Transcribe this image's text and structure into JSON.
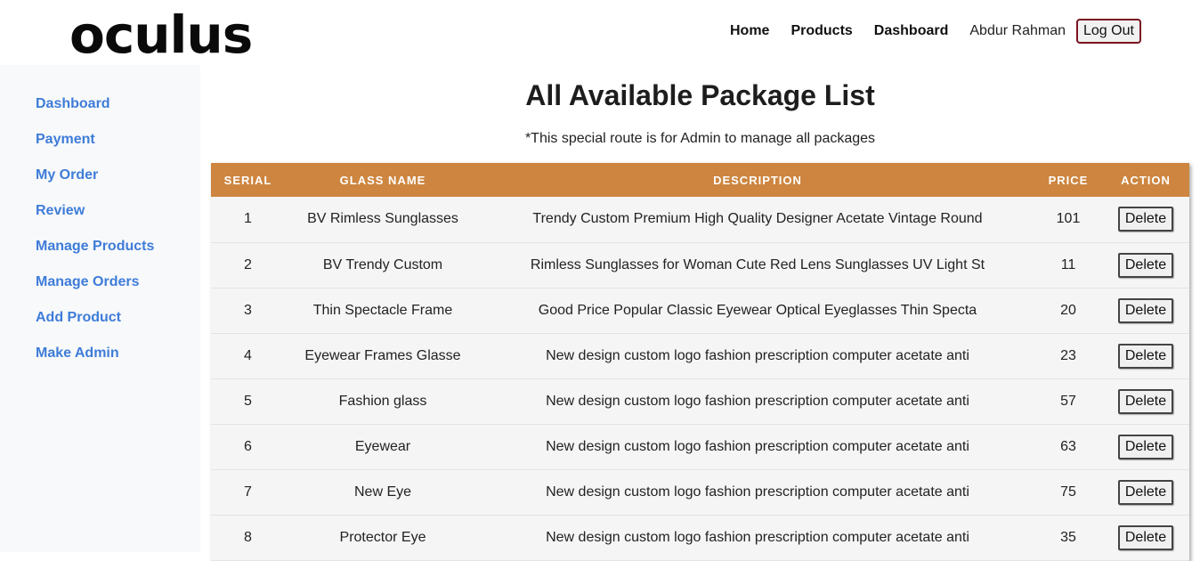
{
  "brand": {
    "logo_text": "oculus"
  },
  "nav": {
    "home": "Home",
    "products": "Products",
    "dashboard": "Dashboard",
    "user_name": "Abdur Rahman",
    "logout": "Log Out"
  },
  "sidebar": {
    "items": [
      {
        "label": "Dashboard"
      },
      {
        "label": "Payment"
      },
      {
        "label": "My Order"
      },
      {
        "label": "Review"
      },
      {
        "label": "Manage Products"
      },
      {
        "label": "Manage Orders"
      },
      {
        "label": "Add Product"
      },
      {
        "label": "Make Admin"
      }
    ]
  },
  "page": {
    "title": "All Available Package List",
    "subtitle": "*This special route is for Admin to manage all packages"
  },
  "table": {
    "headers": [
      "SERIAL",
      "GLASS NAME",
      "DESCRIPTION",
      "PRICE",
      "ACTION"
    ],
    "rows": [
      {
        "serial": "1",
        "name": "BV Rimless Sunglasses",
        "description": "Trendy Custom Premium High Quality Designer Acetate Vintage Round",
        "price": "101",
        "action": "Delete"
      },
      {
        "serial": "2",
        "name": "BV Trendy Custom",
        "description": "Rimless Sunglasses for Woman Cute Red Lens Sunglasses UV Light St",
        "price": "11",
        "action": "Delete"
      },
      {
        "serial": "3",
        "name": "Thin Spectacle Frame",
        "description": "Good Price Popular Classic Eyewear Optical Eyeglasses Thin Specta",
        "price": "20",
        "action": "Delete"
      },
      {
        "serial": "4",
        "name": "Eyewear Frames Glasse",
        "description": "New design custom logo fashion prescription computer acetate anti",
        "price": "23",
        "action": "Delete"
      },
      {
        "serial": "5",
        "name": "Fashion glass",
        "description": "New design custom logo fashion prescription computer acetate anti",
        "price": "57",
        "action": "Delete"
      },
      {
        "serial": "6",
        "name": "Eyewear",
        "description": "New design custom logo fashion prescription computer acetate anti",
        "price": "63",
        "action": "Delete"
      },
      {
        "serial": "7",
        "name": "New Eye",
        "description": "New design custom logo fashion prescription computer acetate anti",
        "price": "75",
        "action": "Delete"
      },
      {
        "serial": "8",
        "name": "Protector Eye",
        "description": "New design custom logo fashion prescription computer acetate anti",
        "price": "35",
        "action": "Delete"
      }
    ]
  },
  "colors": {
    "table_header_bg": "#cd853f",
    "sidebar_link": "#2a6fd6",
    "logout_border": "#7a1420"
  }
}
